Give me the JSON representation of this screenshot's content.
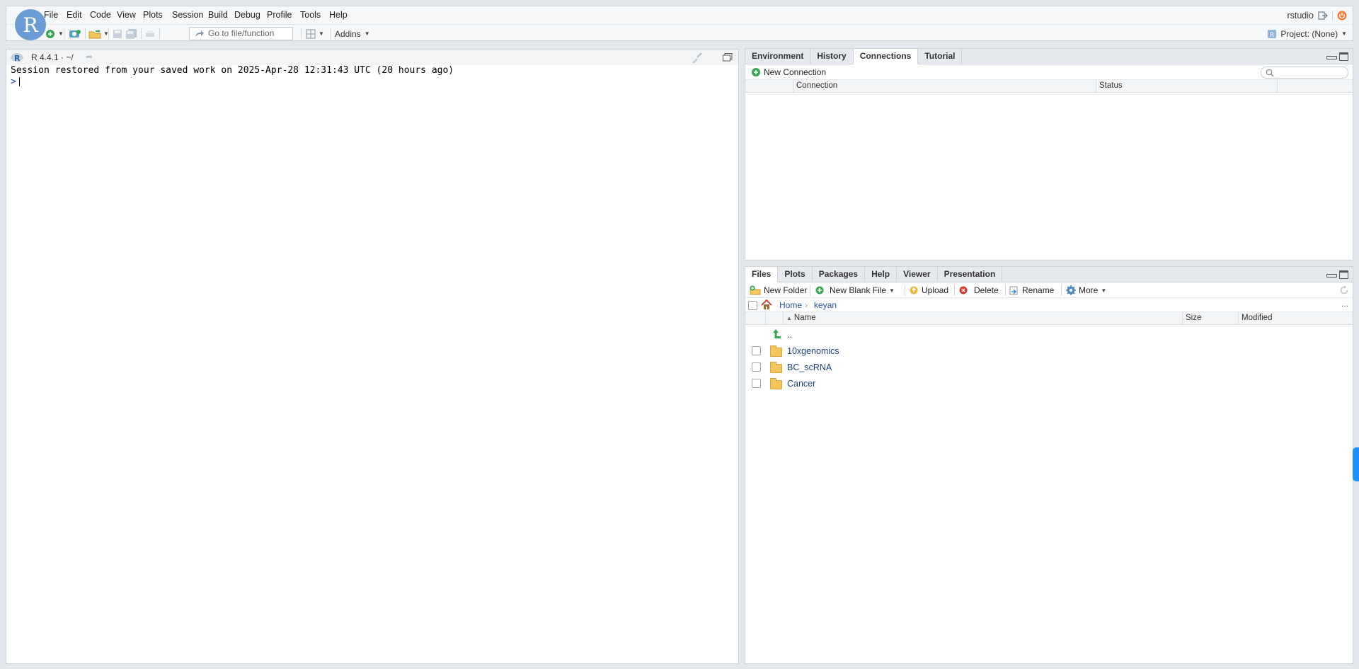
{
  "menubar": {
    "items": [
      "File",
      "Edit",
      "Code",
      "View",
      "Plots",
      "Session",
      "Build",
      "Debug",
      "Profile",
      "Tools",
      "Help"
    ],
    "user": "rstudio"
  },
  "logo": {
    "letter": "R"
  },
  "toolbar": {
    "goto_placeholder": "Go to file/function",
    "addins_label": "Addins",
    "project_label": "Project: (None)"
  },
  "console": {
    "r_version": "R 4.4.1",
    "path": "· ~/",
    "lines": [
      "Session restored from your saved work on 2025-Apr-28 12:31:43 UTC (20 hours ago)"
    ],
    "prompt": ">"
  },
  "connections_pane": {
    "tabs": [
      "Environment",
      "History",
      "Connections",
      "Tutorial"
    ],
    "active_tab": "Connections",
    "new_connection_label": "New Connection",
    "columns": [
      "Connection",
      "Status"
    ]
  },
  "files_pane": {
    "tabs": [
      "Files",
      "Plots",
      "Packages",
      "Help",
      "Viewer",
      "Presentation"
    ],
    "active_tab": "Files",
    "buttons": {
      "new_folder": "New Folder",
      "new_blank_file": "New Blank File",
      "upload": "Upload",
      "delete": "Delete",
      "rename": "Rename",
      "more": "More"
    },
    "breadcrumb": [
      "Home",
      "keyan"
    ],
    "columns": {
      "name": "Name",
      "size": "Size",
      "modified": "Modified"
    },
    "parent_dir": "..",
    "files": [
      {
        "name": "10xgenomics"
      },
      {
        "name": "BC_scRNA"
      },
      {
        "name": "Cancer"
      }
    ],
    "more_menu": "..."
  },
  "colors": {
    "background": "#e4e8ec",
    "logo": "#6b9dd4",
    "link": "#2c52a8",
    "folder": "#f3c75b",
    "scroll_nub": "#1e90ff"
  }
}
